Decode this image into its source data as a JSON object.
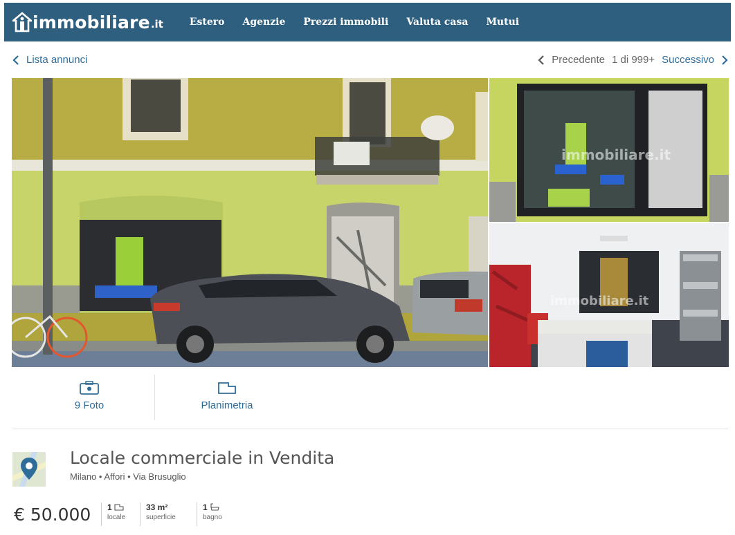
{
  "header": {
    "brand": "immobiliare",
    "tld": ".it",
    "nav": [
      "Estero",
      "Agenzie",
      "Prezzi immobili",
      "Valuta casa",
      "Mutui"
    ],
    "bg_color": "#2f5f7e"
  },
  "subnav": {
    "back_label": "Lista annunci",
    "prev_label": "Precedente",
    "counter": "1 di 999+",
    "next_label": "Successivo"
  },
  "gallery": {
    "watermark": "immobiliare.it"
  },
  "actions": {
    "photos_label": "9 Foto",
    "floorplan_label": "Planimetria"
  },
  "listing": {
    "title": "Locale commerciale in Vendita",
    "location": "Milano • Affori • Via Brusuglio",
    "price": "€ 50.000",
    "features": [
      {
        "value": "1",
        "label": "locale",
        "icon": "room-icon"
      },
      {
        "value": "33 m²",
        "label": "superficie",
        "icon": ""
      },
      {
        "value": "1",
        "label": "bagno",
        "icon": "bath-icon"
      }
    ]
  },
  "colors": {
    "link": "#2e6d9a",
    "wall_green": "#c9d868",
    "wall_ochre": "#b4a63a"
  }
}
